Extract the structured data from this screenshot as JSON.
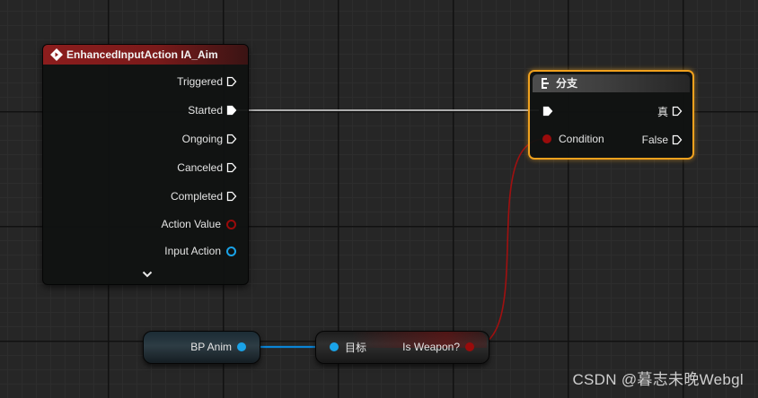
{
  "input_node": {
    "title": "EnhancedInputAction IA_Aim",
    "pins": [
      {
        "label": "Triggered",
        "type": "exec",
        "connected": false
      },
      {
        "label": "Started",
        "type": "exec",
        "connected": true
      },
      {
        "label": "Ongoing",
        "type": "exec",
        "connected": false
      },
      {
        "label": "Canceled",
        "type": "exec",
        "connected": false
      },
      {
        "label": "Completed",
        "type": "exec",
        "connected": false
      },
      {
        "label": "Action Value",
        "type": "bool",
        "connected": false
      },
      {
        "label": "Input Action",
        "type": "object",
        "connected": false
      }
    ],
    "expand_icon": "chevron-down-icon"
  },
  "branch_node": {
    "title": "分支",
    "exec_in_label": "",
    "condition_label": "Condition",
    "true_label": "真",
    "false_label": "False",
    "selected": true
  },
  "var_node": {
    "label": "BP Anim"
  },
  "func_node": {
    "target_label": "目标",
    "output_label": "Is Weapon?"
  },
  "watermark": "CSDN @暮志未晚Webgl",
  "colors": {
    "event_header": "#8c1d1d",
    "selection": "#f0a11e",
    "exec_pin": "#ffffff",
    "bool_pin": "#9a0b0b",
    "object_pin": "#1aa3e8",
    "bool_wire": "#a01010",
    "object_wire": "#0b84d6",
    "exec_wire": "#d8d8d8"
  }
}
